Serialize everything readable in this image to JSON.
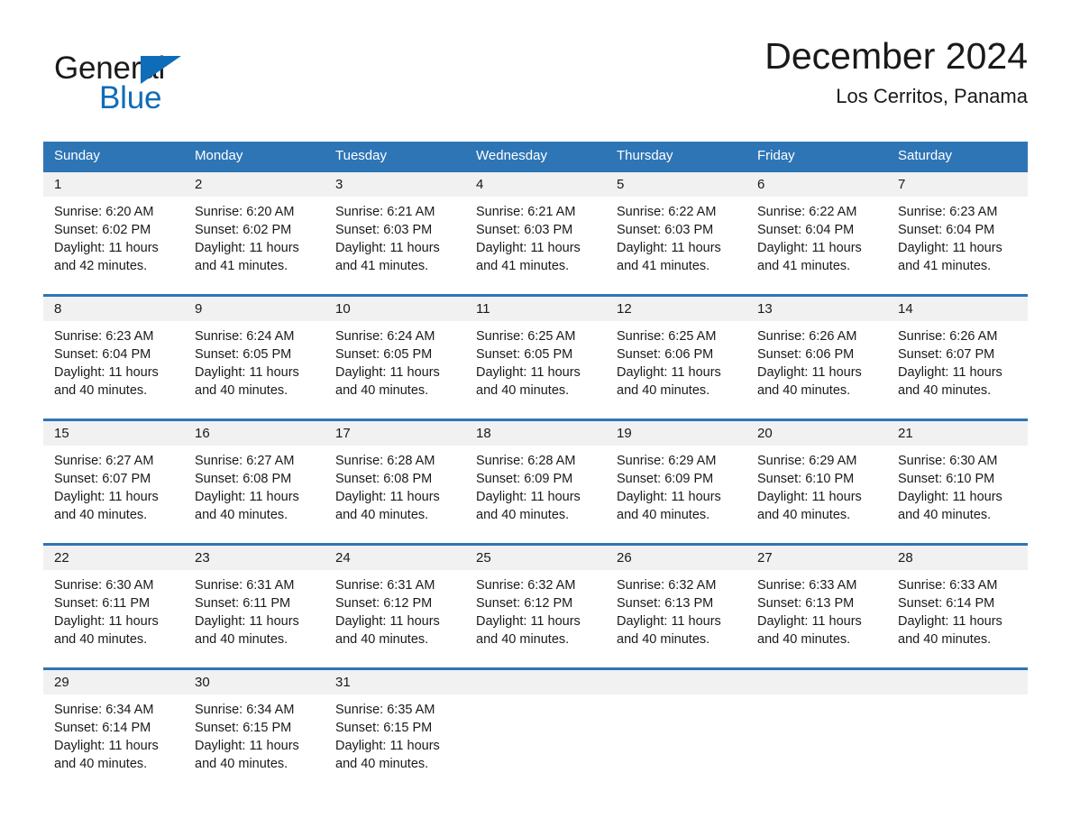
{
  "brand": {
    "name_part1": "General",
    "name_part2": "Blue",
    "accent_color": "#0f6cb8"
  },
  "header": {
    "month_title": "December 2024",
    "location": "Los Cerritos, Panama"
  },
  "theme": {
    "header_blue": "#2e75b6",
    "date_band_gray": "#f1f1f1",
    "text_color": "#1a1a1a"
  },
  "day_headers": [
    "Sunday",
    "Monday",
    "Tuesday",
    "Wednesday",
    "Thursday",
    "Friday",
    "Saturday"
  ],
  "weeks": [
    {
      "days": [
        {
          "date": "1",
          "sunrise": "Sunrise: 6:20 AM",
          "sunset": "Sunset: 6:02 PM",
          "daylight_line1": "Daylight: 11 hours",
          "daylight_line2": "and 42 minutes."
        },
        {
          "date": "2",
          "sunrise": "Sunrise: 6:20 AM",
          "sunset": "Sunset: 6:02 PM",
          "daylight_line1": "Daylight: 11 hours",
          "daylight_line2": "and 41 minutes."
        },
        {
          "date": "3",
          "sunrise": "Sunrise: 6:21 AM",
          "sunset": "Sunset: 6:03 PM",
          "daylight_line1": "Daylight: 11 hours",
          "daylight_line2": "and 41 minutes."
        },
        {
          "date": "4",
          "sunrise": "Sunrise: 6:21 AM",
          "sunset": "Sunset: 6:03 PM",
          "daylight_line1": "Daylight: 11 hours",
          "daylight_line2": "and 41 minutes."
        },
        {
          "date": "5",
          "sunrise": "Sunrise: 6:22 AM",
          "sunset": "Sunset: 6:03 PM",
          "daylight_line1": "Daylight: 11 hours",
          "daylight_line2": "and 41 minutes."
        },
        {
          "date": "6",
          "sunrise": "Sunrise: 6:22 AM",
          "sunset": "Sunset: 6:04 PM",
          "daylight_line1": "Daylight: 11 hours",
          "daylight_line2": "and 41 minutes."
        },
        {
          "date": "7",
          "sunrise": "Sunrise: 6:23 AM",
          "sunset": "Sunset: 6:04 PM",
          "daylight_line1": "Daylight: 11 hours",
          "daylight_line2": "and 41 minutes."
        }
      ]
    },
    {
      "days": [
        {
          "date": "8",
          "sunrise": "Sunrise: 6:23 AM",
          "sunset": "Sunset: 6:04 PM",
          "daylight_line1": "Daylight: 11 hours",
          "daylight_line2": "and 40 minutes."
        },
        {
          "date": "9",
          "sunrise": "Sunrise: 6:24 AM",
          "sunset": "Sunset: 6:05 PM",
          "daylight_line1": "Daylight: 11 hours",
          "daylight_line2": "and 40 minutes."
        },
        {
          "date": "10",
          "sunrise": "Sunrise: 6:24 AM",
          "sunset": "Sunset: 6:05 PM",
          "daylight_line1": "Daylight: 11 hours",
          "daylight_line2": "and 40 minutes."
        },
        {
          "date": "11",
          "sunrise": "Sunrise: 6:25 AM",
          "sunset": "Sunset: 6:05 PM",
          "daylight_line1": "Daylight: 11 hours",
          "daylight_line2": "and 40 minutes."
        },
        {
          "date": "12",
          "sunrise": "Sunrise: 6:25 AM",
          "sunset": "Sunset: 6:06 PM",
          "daylight_line1": "Daylight: 11 hours",
          "daylight_line2": "and 40 minutes."
        },
        {
          "date": "13",
          "sunrise": "Sunrise: 6:26 AM",
          "sunset": "Sunset: 6:06 PM",
          "daylight_line1": "Daylight: 11 hours",
          "daylight_line2": "and 40 minutes."
        },
        {
          "date": "14",
          "sunrise": "Sunrise: 6:26 AM",
          "sunset": "Sunset: 6:07 PM",
          "daylight_line1": "Daylight: 11 hours",
          "daylight_line2": "and 40 minutes."
        }
      ]
    },
    {
      "days": [
        {
          "date": "15",
          "sunrise": "Sunrise: 6:27 AM",
          "sunset": "Sunset: 6:07 PM",
          "daylight_line1": "Daylight: 11 hours",
          "daylight_line2": "and 40 minutes."
        },
        {
          "date": "16",
          "sunrise": "Sunrise: 6:27 AM",
          "sunset": "Sunset: 6:08 PM",
          "daylight_line1": "Daylight: 11 hours",
          "daylight_line2": "and 40 minutes."
        },
        {
          "date": "17",
          "sunrise": "Sunrise: 6:28 AM",
          "sunset": "Sunset: 6:08 PM",
          "daylight_line1": "Daylight: 11 hours",
          "daylight_line2": "and 40 minutes."
        },
        {
          "date": "18",
          "sunrise": "Sunrise: 6:28 AM",
          "sunset": "Sunset: 6:09 PM",
          "daylight_line1": "Daylight: 11 hours",
          "daylight_line2": "and 40 minutes."
        },
        {
          "date": "19",
          "sunrise": "Sunrise: 6:29 AM",
          "sunset": "Sunset: 6:09 PM",
          "daylight_line1": "Daylight: 11 hours",
          "daylight_line2": "and 40 minutes."
        },
        {
          "date": "20",
          "sunrise": "Sunrise: 6:29 AM",
          "sunset": "Sunset: 6:10 PM",
          "daylight_line1": "Daylight: 11 hours",
          "daylight_line2": "and 40 minutes."
        },
        {
          "date": "21",
          "sunrise": "Sunrise: 6:30 AM",
          "sunset": "Sunset: 6:10 PM",
          "daylight_line1": "Daylight: 11 hours",
          "daylight_line2": "and 40 minutes."
        }
      ]
    },
    {
      "days": [
        {
          "date": "22",
          "sunrise": "Sunrise: 6:30 AM",
          "sunset": "Sunset: 6:11 PM",
          "daylight_line1": "Daylight: 11 hours",
          "daylight_line2": "and 40 minutes."
        },
        {
          "date": "23",
          "sunrise": "Sunrise: 6:31 AM",
          "sunset": "Sunset: 6:11 PM",
          "daylight_line1": "Daylight: 11 hours",
          "daylight_line2": "and 40 minutes."
        },
        {
          "date": "24",
          "sunrise": "Sunrise: 6:31 AM",
          "sunset": "Sunset: 6:12 PM",
          "daylight_line1": "Daylight: 11 hours",
          "daylight_line2": "and 40 minutes."
        },
        {
          "date": "25",
          "sunrise": "Sunrise: 6:32 AM",
          "sunset": "Sunset: 6:12 PM",
          "daylight_line1": "Daylight: 11 hours",
          "daylight_line2": "and 40 minutes."
        },
        {
          "date": "26",
          "sunrise": "Sunrise: 6:32 AM",
          "sunset": "Sunset: 6:13 PM",
          "daylight_line1": "Daylight: 11 hours",
          "daylight_line2": "and 40 minutes."
        },
        {
          "date": "27",
          "sunrise": "Sunrise: 6:33 AM",
          "sunset": "Sunset: 6:13 PM",
          "daylight_line1": "Daylight: 11 hours",
          "daylight_line2": "and 40 minutes."
        },
        {
          "date": "28",
          "sunrise": "Sunrise: 6:33 AM",
          "sunset": "Sunset: 6:14 PM",
          "daylight_line1": "Daylight: 11 hours",
          "daylight_line2": "and 40 minutes."
        }
      ]
    },
    {
      "days": [
        {
          "date": "29",
          "sunrise": "Sunrise: 6:34 AM",
          "sunset": "Sunset: 6:14 PM",
          "daylight_line1": "Daylight: 11 hours",
          "daylight_line2": "and 40 minutes."
        },
        {
          "date": "30",
          "sunrise": "Sunrise: 6:34 AM",
          "sunset": "Sunset: 6:15 PM",
          "daylight_line1": "Daylight: 11 hours",
          "daylight_line2": "and 40 minutes."
        },
        {
          "date": "31",
          "sunrise": "Sunrise: 6:35 AM",
          "sunset": "Sunset: 6:15 PM",
          "daylight_line1": "Daylight: 11 hours",
          "daylight_line2": "and 40 minutes."
        },
        {
          "date": "",
          "sunrise": "",
          "sunset": "",
          "daylight_line1": "",
          "daylight_line2": ""
        },
        {
          "date": "",
          "sunrise": "",
          "sunset": "",
          "daylight_line1": "",
          "daylight_line2": ""
        },
        {
          "date": "",
          "sunrise": "",
          "sunset": "",
          "daylight_line1": "",
          "daylight_line2": ""
        },
        {
          "date": "",
          "sunrise": "",
          "sunset": "",
          "daylight_line1": "",
          "daylight_line2": ""
        }
      ]
    }
  ]
}
